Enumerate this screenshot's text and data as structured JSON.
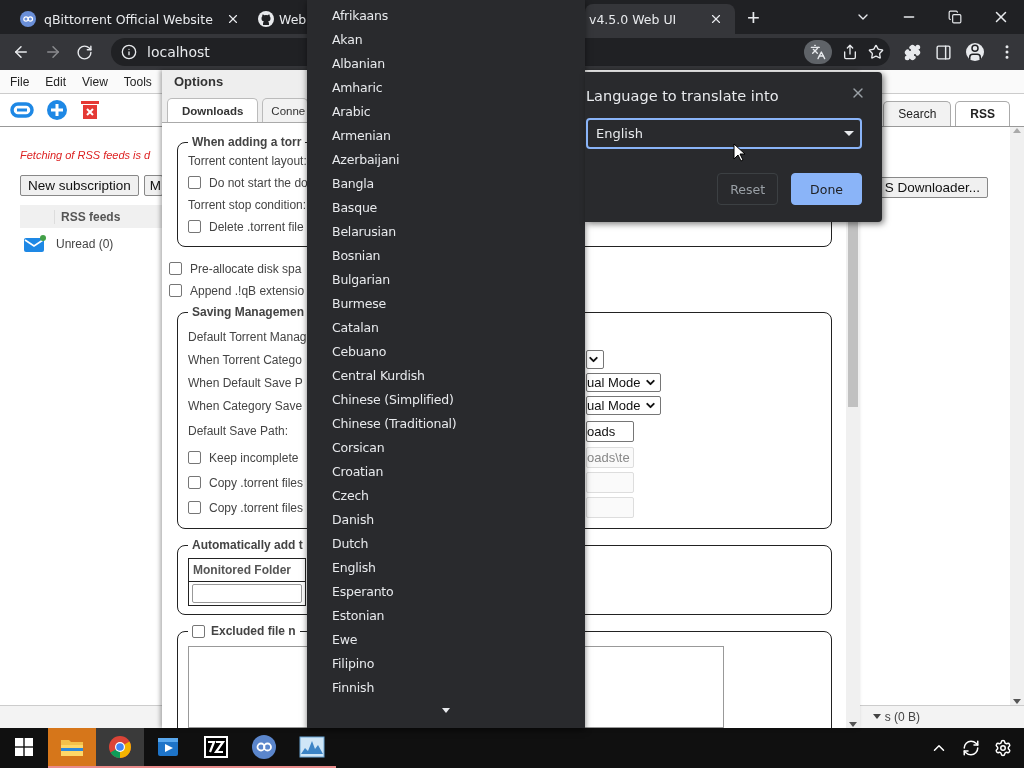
{
  "browser": {
    "tabs": [
      {
        "title": "qBittorrent Official Website",
        "selected": false,
        "kind": "qb"
      },
      {
        "title": "Web",
        "selected": false,
        "kind": "github"
      },
      {
        "title": "v4.5.0 Web UI",
        "selected": true,
        "kind": "none"
      }
    ],
    "new_tab": "+",
    "address": "localhost"
  },
  "page": {
    "menu": [
      "File",
      "Edit",
      "View",
      "Tools"
    ],
    "right_tabs": [
      {
        "label": "Search",
        "selected": false
      },
      {
        "label": "RSS",
        "selected": true
      }
    ],
    "notice": "Fetching of RSS feeds is d",
    "buttons": [
      "New subscription",
      "M"
    ],
    "right_button": "S Downloader...",
    "feeds_header": "RSS feeds",
    "feeds": [
      {
        "label": "Unread (0)"
      }
    ],
    "status": "s (0 B)"
  },
  "options": {
    "title": "Options",
    "tabs": [
      {
        "label": "Downloads",
        "selected": true
      },
      {
        "label": "Conne",
        "selected": false
      }
    ],
    "adding": {
      "legend": "When adding a torr",
      "rows": [
        {
          "kind": "label",
          "text": "Torrent content layout:"
        },
        {
          "kind": "checkbox",
          "text": "Do not start the do",
          "checked": false
        },
        {
          "kind": "label",
          "text": "Torrent stop condition:"
        },
        {
          "kind": "checkbox",
          "text": "Delete .torrent file",
          "checked": false
        }
      ]
    },
    "general": [
      {
        "text": "Pre-allocate disk spa",
        "checked": false
      },
      {
        "text": "Append .!qB extensio",
        "checked": false
      }
    ],
    "saving": {
      "legend": "Saving Managemen",
      "rows": [
        {
          "kind": "label",
          "label": "Default Torrent Manag"
        },
        {
          "kind": "select",
          "label": "When Torrent Catego"
        },
        {
          "kind": "select",
          "label": "When Default Save P",
          "value": "ual Mode"
        },
        {
          "kind": "select",
          "label": "When Category Save",
          "value": "ual Mode"
        },
        {
          "kind": "input",
          "label": "Default Save Path:",
          "value": "oads",
          "disabled": false
        },
        {
          "kind": "checkbox",
          "label": "Keep incomplete",
          "checked": false,
          "value": "oads\\te",
          "disabled": true
        },
        {
          "kind": "checkbox",
          "label": "Copy .torrent files",
          "checked": false,
          "disabled": true
        },
        {
          "kind": "checkbox",
          "label": "Copy .torrent files",
          "checked": false,
          "disabled": true
        }
      ]
    },
    "watch": {
      "legend": "Automatically add t",
      "column": "Monitored Folder"
    },
    "excluded": {
      "label": "Excluded file n",
      "checked": false
    }
  },
  "language_menu": {
    "items": [
      "Afrikaans",
      "Akan",
      "Albanian",
      "Amharic",
      "Arabic",
      "Armenian",
      "Azerbaijani",
      "Bangla",
      "Basque",
      "Belarusian",
      "Bosnian",
      "Bulgarian",
      "Burmese",
      "Catalan",
      "Cebuano",
      "Central Kurdish",
      "Chinese (Simplified)",
      "Chinese (Traditional)",
      "Corsican",
      "Croatian",
      "Czech",
      "Danish",
      "Dutch",
      "English",
      "Esperanto",
      "Estonian",
      "Ewe",
      "Filipino",
      "Finnish"
    ]
  },
  "translate": {
    "title": "Language to translate into",
    "language": "English",
    "reset": "Reset",
    "done": "Done"
  },
  "taskbar": {
    "apps": [
      {
        "kind": "explorer",
        "flashing": true,
        "selected": false
      },
      {
        "kind": "chrome",
        "flashing": false,
        "selected": true
      },
      {
        "kind": "player",
        "flashing": false,
        "selected": false
      },
      {
        "kind": "sevenzip",
        "flashing": false,
        "selected": false
      },
      {
        "kind": "qb",
        "flashing": false,
        "selected": false
      },
      {
        "kind": "monitor",
        "flashing": false,
        "selected": false
      }
    ]
  }
}
